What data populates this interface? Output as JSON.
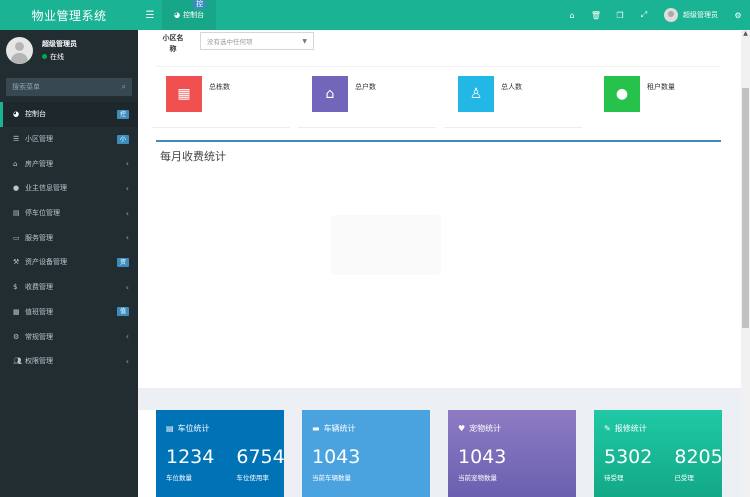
{
  "app": {
    "title": "物业管理系统"
  },
  "header": {
    "menu_icon": "bars-icon",
    "tab": {
      "label": "控制台",
      "badge": "控"
    },
    "user": {
      "name": "超级管理员"
    },
    "icons": [
      "home-icon",
      "trash-icon",
      "copy-icon",
      "fullscreen-icon",
      "settings-icon"
    ]
  },
  "sidebar": {
    "user": {
      "name": "超级管理员",
      "status": "在线"
    },
    "search": {
      "placeholder": "搜索菜单"
    },
    "items": [
      {
        "label": "控制台",
        "icon": "dashboard-icon",
        "badge": "控",
        "active": true
      },
      {
        "label": "小区管理",
        "icon": "list-icon",
        "badge": "小"
      },
      {
        "label": "房产管理",
        "icon": "home-icon",
        "arrow": "‹"
      },
      {
        "label": "业主信息管理",
        "icon": "user-icon",
        "arrow": "‹"
      },
      {
        "label": "停车位管理",
        "icon": "film-icon",
        "arrow": "‹"
      },
      {
        "label": "服务管理",
        "icon": "keyboard-icon",
        "arrow": "‹"
      },
      {
        "label": "资产设备管理",
        "icon": "gavel-icon",
        "badge": "资"
      },
      {
        "label": "收费管理",
        "icon": "dollar-icon",
        "arrow": "‹"
      },
      {
        "label": "值班管理",
        "icon": "calendar-icon",
        "badge": "值"
      },
      {
        "label": "常规管理",
        "icon": "cogs-icon",
        "arrow": "‹"
      },
      {
        "label": "权限管理",
        "icon": "users-icon",
        "arrow": "‹"
      }
    ]
  },
  "filter": {
    "label": "小区名称",
    "placeholder": "没有选中任何项"
  },
  "info_boxes": [
    {
      "label": "总栋数",
      "color": "#dd4b39",
      "icon": "building-icon"
    },
    {
      "label": "总户数",
      "color": "#605ca8",
      "icon": "home-icon"
    },
    {
      "label": "总人数",
      "color": "#00c0ef",
      "icon": "male-icon"
    },
    {
      "label": "租户数量",
      "color": "#00a65a",
      "icon": "user-icon"
    }
  ],
  "chart": {
    "title": "每月收费统计"
  },
  "stat_cards": [
    {
      "title": "车位统计",
      "icon": "film-icon",
      "bg": "#0073b7",
      "values": [
        {
          "num": "1234",
          "label": "车位数量"
        },
        {
          "num": "6754",
          "label": "车位使用率"
        }
      ]
    },
    {
      "title": "车辆统计",
      "icon": "truck-icon",
      "bg": "#3c9ae0",
      "values": [
        {
          "num": "1043",
          "label": "当前车辆数量"
        }
      ]
    },
    {
      "title": "宠物统计",
      "icon": "heart-icon",
      "bg": "#7b6fc0",
      "values": [
        {
          "num": "1043",
          "label": "当前宠物数量"
        }
      ]
    },
    {
      "title": "报修统计",
      "icon": "wrench-icon",
      "bg": "#1ab394",
      "values": [
        {
          "num": "5302",
          "label": "待受理"
        },
        {
          "num": "8205",
          "label": "已受理"
        }
      ]
    }
  ]
}
